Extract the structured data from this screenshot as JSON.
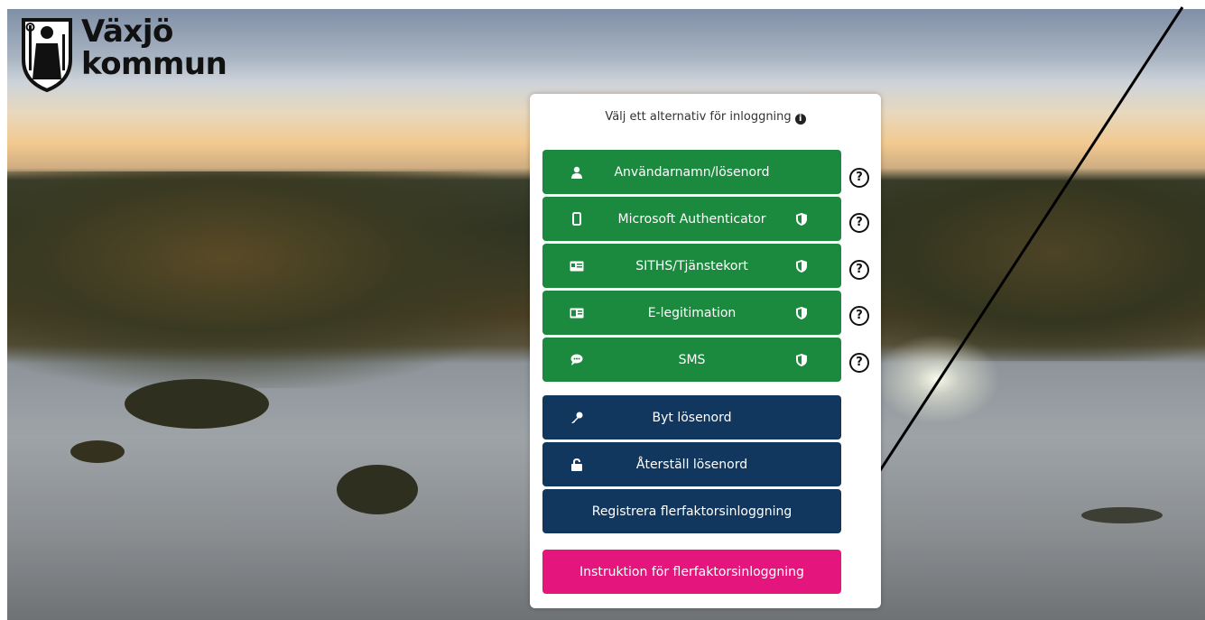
{
  "logo": {
    "line1": "Växjö",
    "line2": "kommun"
  },
  "login": {
    "heading": "Välj ett alternativ för inloggning",
    "methods": [
      {
        "label": "Användarnamn/lösenord",
        "icon": "user-icon",
        "shield": false,
        "help": "?"
      },
      {
        "label": "Microsoft Authenticator",
        "icon": "phone-icon",
        "shield": true,
        "help": "?"
      },
      {
        "label": "SITHS/Tjänstekort",
        "icon": "card-icon",
        "shield": true,
        "help": "?"
      },
      {
        "label": "E-legitimation",
        "icon": "id-card-icon",
        "shield": true,
        "help": "?"
      },
      {
        "label": "SMS",
        "icon": "chat-icon",
        "shield": true,
        "help": "?"
      }
    ],
    "change_password": "Byt lösenord",
    "reset_password": "Återställ lösenord",
    "register_mfa": "Registrera flerfaktorsinloggning",
    "mfa_instructions": "Instruktion för flerfaktorsinloggning"
  },
  "colors": {
    "green": "#1b8a3e",
    "navy": "#12375e",
    "pink": "#e4167d"
  }
}
